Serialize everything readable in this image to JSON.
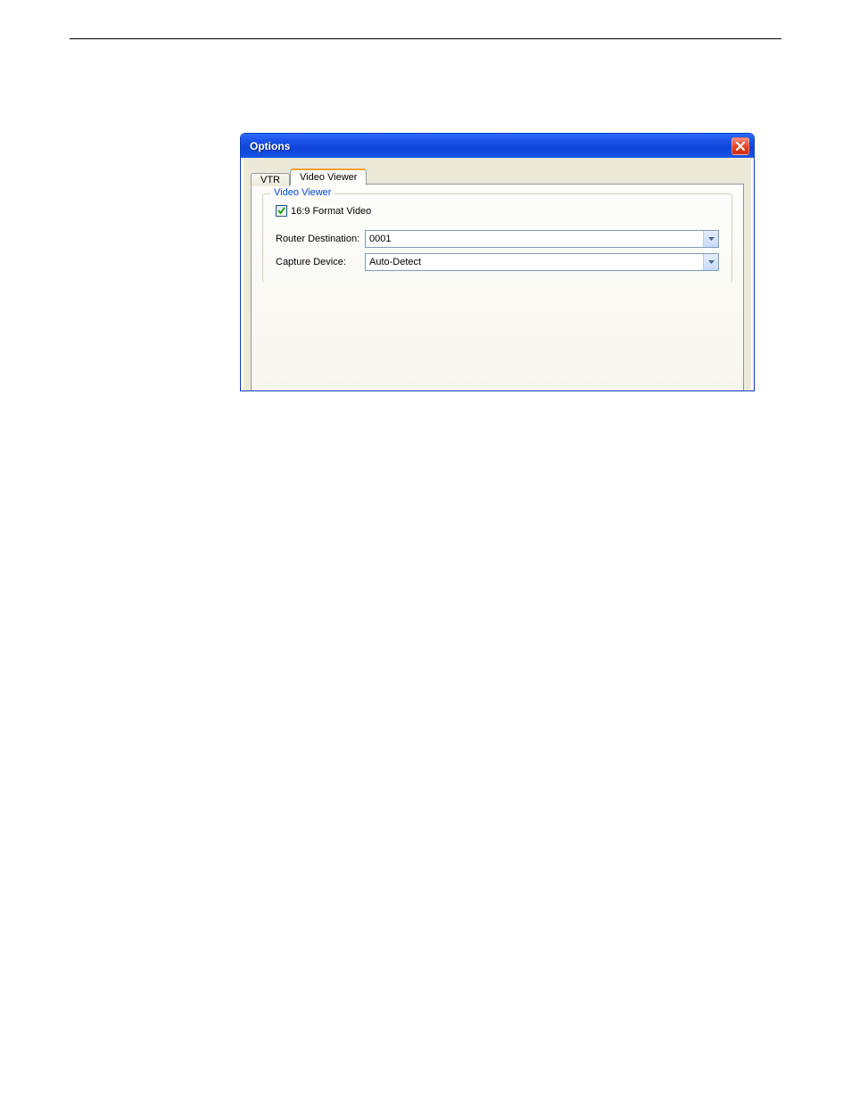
{
  "dialog": {
    "title": "Options"
  },
  "tabs": {
    "vtr": "VTR",
    "video_viewer": "Video Viewer"
  },
  "group": {
    "legend": "Video Viewer"
  },
  "checkbox": {
    "label": "16:9 Format Video",
    "checked": true
  },
  "router_destination": {
    "label": "Router Destination:",
    "value": "0001"
  },
  "capture_device": {
    "label": "Capture Device:",
    "value": "Auto-Detect"
  }
}
